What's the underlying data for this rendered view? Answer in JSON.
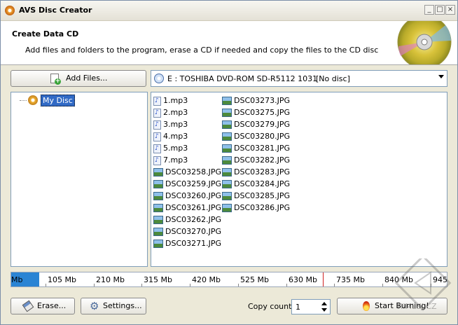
{
  "window": {
    "title": "AVS Disc Creator"
  },
  "header": {
    "title": "Create Data CD",
    "subtitle": "Add files and folders to the program, erase a CD if needed and copy the files to the CD disc"
  },
  "toolbar": {
    "add_files_label": "Add Files..."
  },
  "drive": {
    "name": "E : TOSHIBA  DVD-ROM SD-R5112 1031",
    "status": "[No disc]"
  },
  "tree": {
    "root_label": "My Disc"
  },
  "files": {
    "col1": [
      {
        "name": "1.mp3",
        "icon": "audio-file-icon"
      },
      {
        "name": "2.mp3",
        "icon": "audio-file-icon"
      },
      {
        "name": "3.mp3",
        "icon": "audio-file-icon"
      },
      {
        "name": "4.mp3",
        "icon": "audio-file-icon"
      },
      {
        "name": "5.mp3",
        "icon": "audio-file-icon"
      },
      {
        "name": "7.mp3",
        "icon": "audio-file-icon"
      },
      {
        "name": "DSC03258.JPG",
        "icon": "image-file-icon"
      },
      {
        "name": "DSC03259.JPG",
        "icon": "image-file-icon"
      },
      {
        "name": "DSC03260.JPG",
        "icon": "image-file-icon"
      },
      {
        "name": "DSC03261.JPG",
        "icon": "image-file-icon"
      },
      {
        "name": "DSC03262.JPG",
        "icon": "image-file-icon"
      },
      {
        "name": "DSC03270.JPG",
        "icon": "image-file-icon"
      },
      {
        "name": "DSC03271.JPG",
        "icon": "image-file-icon"
      }
    ],
    "col2": [
      {
        "name": "DSC03273.JPG",
        "icon": "image-file-icon"
      },
      {
        "name": "DSC03275.JPG",
        "icon": "image-file-icon"
      },
      {
        "name": "DSC03279.JPG",
        "icon": "image-file-icon"
      },
      {
        "name": "DSC03280.JPG",
        "icon": "image-file-icon"
      },
      {
        "name": "DSC03281.JPG",
        "icon": "image-file-icon"
      },
      {
        "name": "DSC03282.JPG",
        "icon": "image-file-icon"
      },
      {
        "name": "DSC03283.JPG",
        "icon": "image-file-icon"
      },
      {
        "name": "DSC03284.JPG",
        "icon": "image-file-icon"
      },
      {
        "name": "DSC03285.JPG",
        "icon": "image-file-icon"
      },
      {
        "name": "DSC03286.JPG",
        "icon": "image-file-icon"
      }
    ]
  },
  "capacity": {
    "labels": [
      "Mb",
      "105 Mb",
      "210 Mb",
      "315 Mb",
      "420 Mb",
      "525 Mb",
      "630 Mb",
      "735 Mb",
      "840 Mb",
      "945 Mb"
    ],
    "used_mb": 40,
    "limit_mb": 700,
    "max_mb": 945,
    "fill_color": "#2a84d4",
    "limit_color": "#d02020"
  },
  "footer": {
    "erase_label": "Erase...",
    "settings_label": "Settings...",
    "copy_count_label": "Copy count:",
    "copy_count_value": "1",
    "start_burning_label": "Start Burning!"
  },
  "watermark": "HIMLUJ.CZ"
}
